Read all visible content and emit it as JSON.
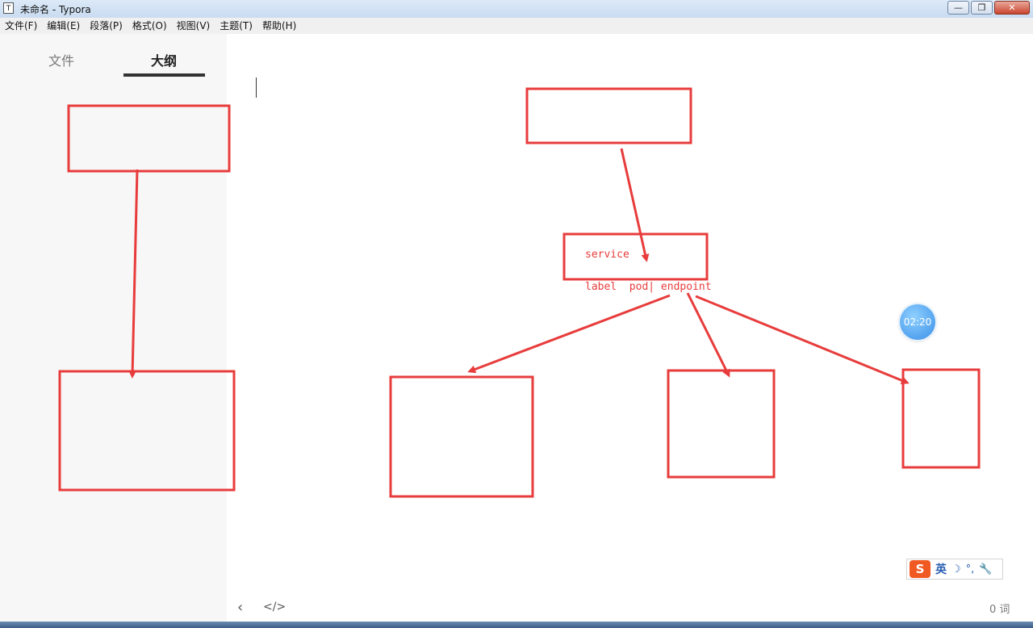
{
  "window": {
    "title": "未命名 - Typora",
    "app_icon": "T",
    "buttons": {
      "minimize": "—",
      "maximize": "❐",
      "close": "✕"
    }
  },
  "menu": [
    "文件(F)",
    "编辑(E)",
    "段落(P)",
    "格式(O)",
    "视图(V)",
    "主题(T)",
    "帮助(H)"
  ],
  "sidebar": {
    "tabs": {
      "files": "文件",
      "outline": "大纲"
    },
    "active_tab": "outline"
  },
  "diagram": {
    "service_label": "service",
    "relation_label": "label  pod| endpoint",
    "stroke_color": "#e83c3c"
  },
  "timer": {
    "value": "02:20"
  },
  "ime": {
    "logo": "S",
    "lang": "英",
    "moon": "☽",
    "punct": "°,",
    "tool": "🔧"
  },
  "footer": {
    "back_icon": "‹",
    "source_icon": "</>",
    "word_count": "0 词"
  },
  "colors": {
    "accent": "#e83c3c",
    "timer": "#3a8fe8",
    "ime_logo": "#f05a22"
  }
}
